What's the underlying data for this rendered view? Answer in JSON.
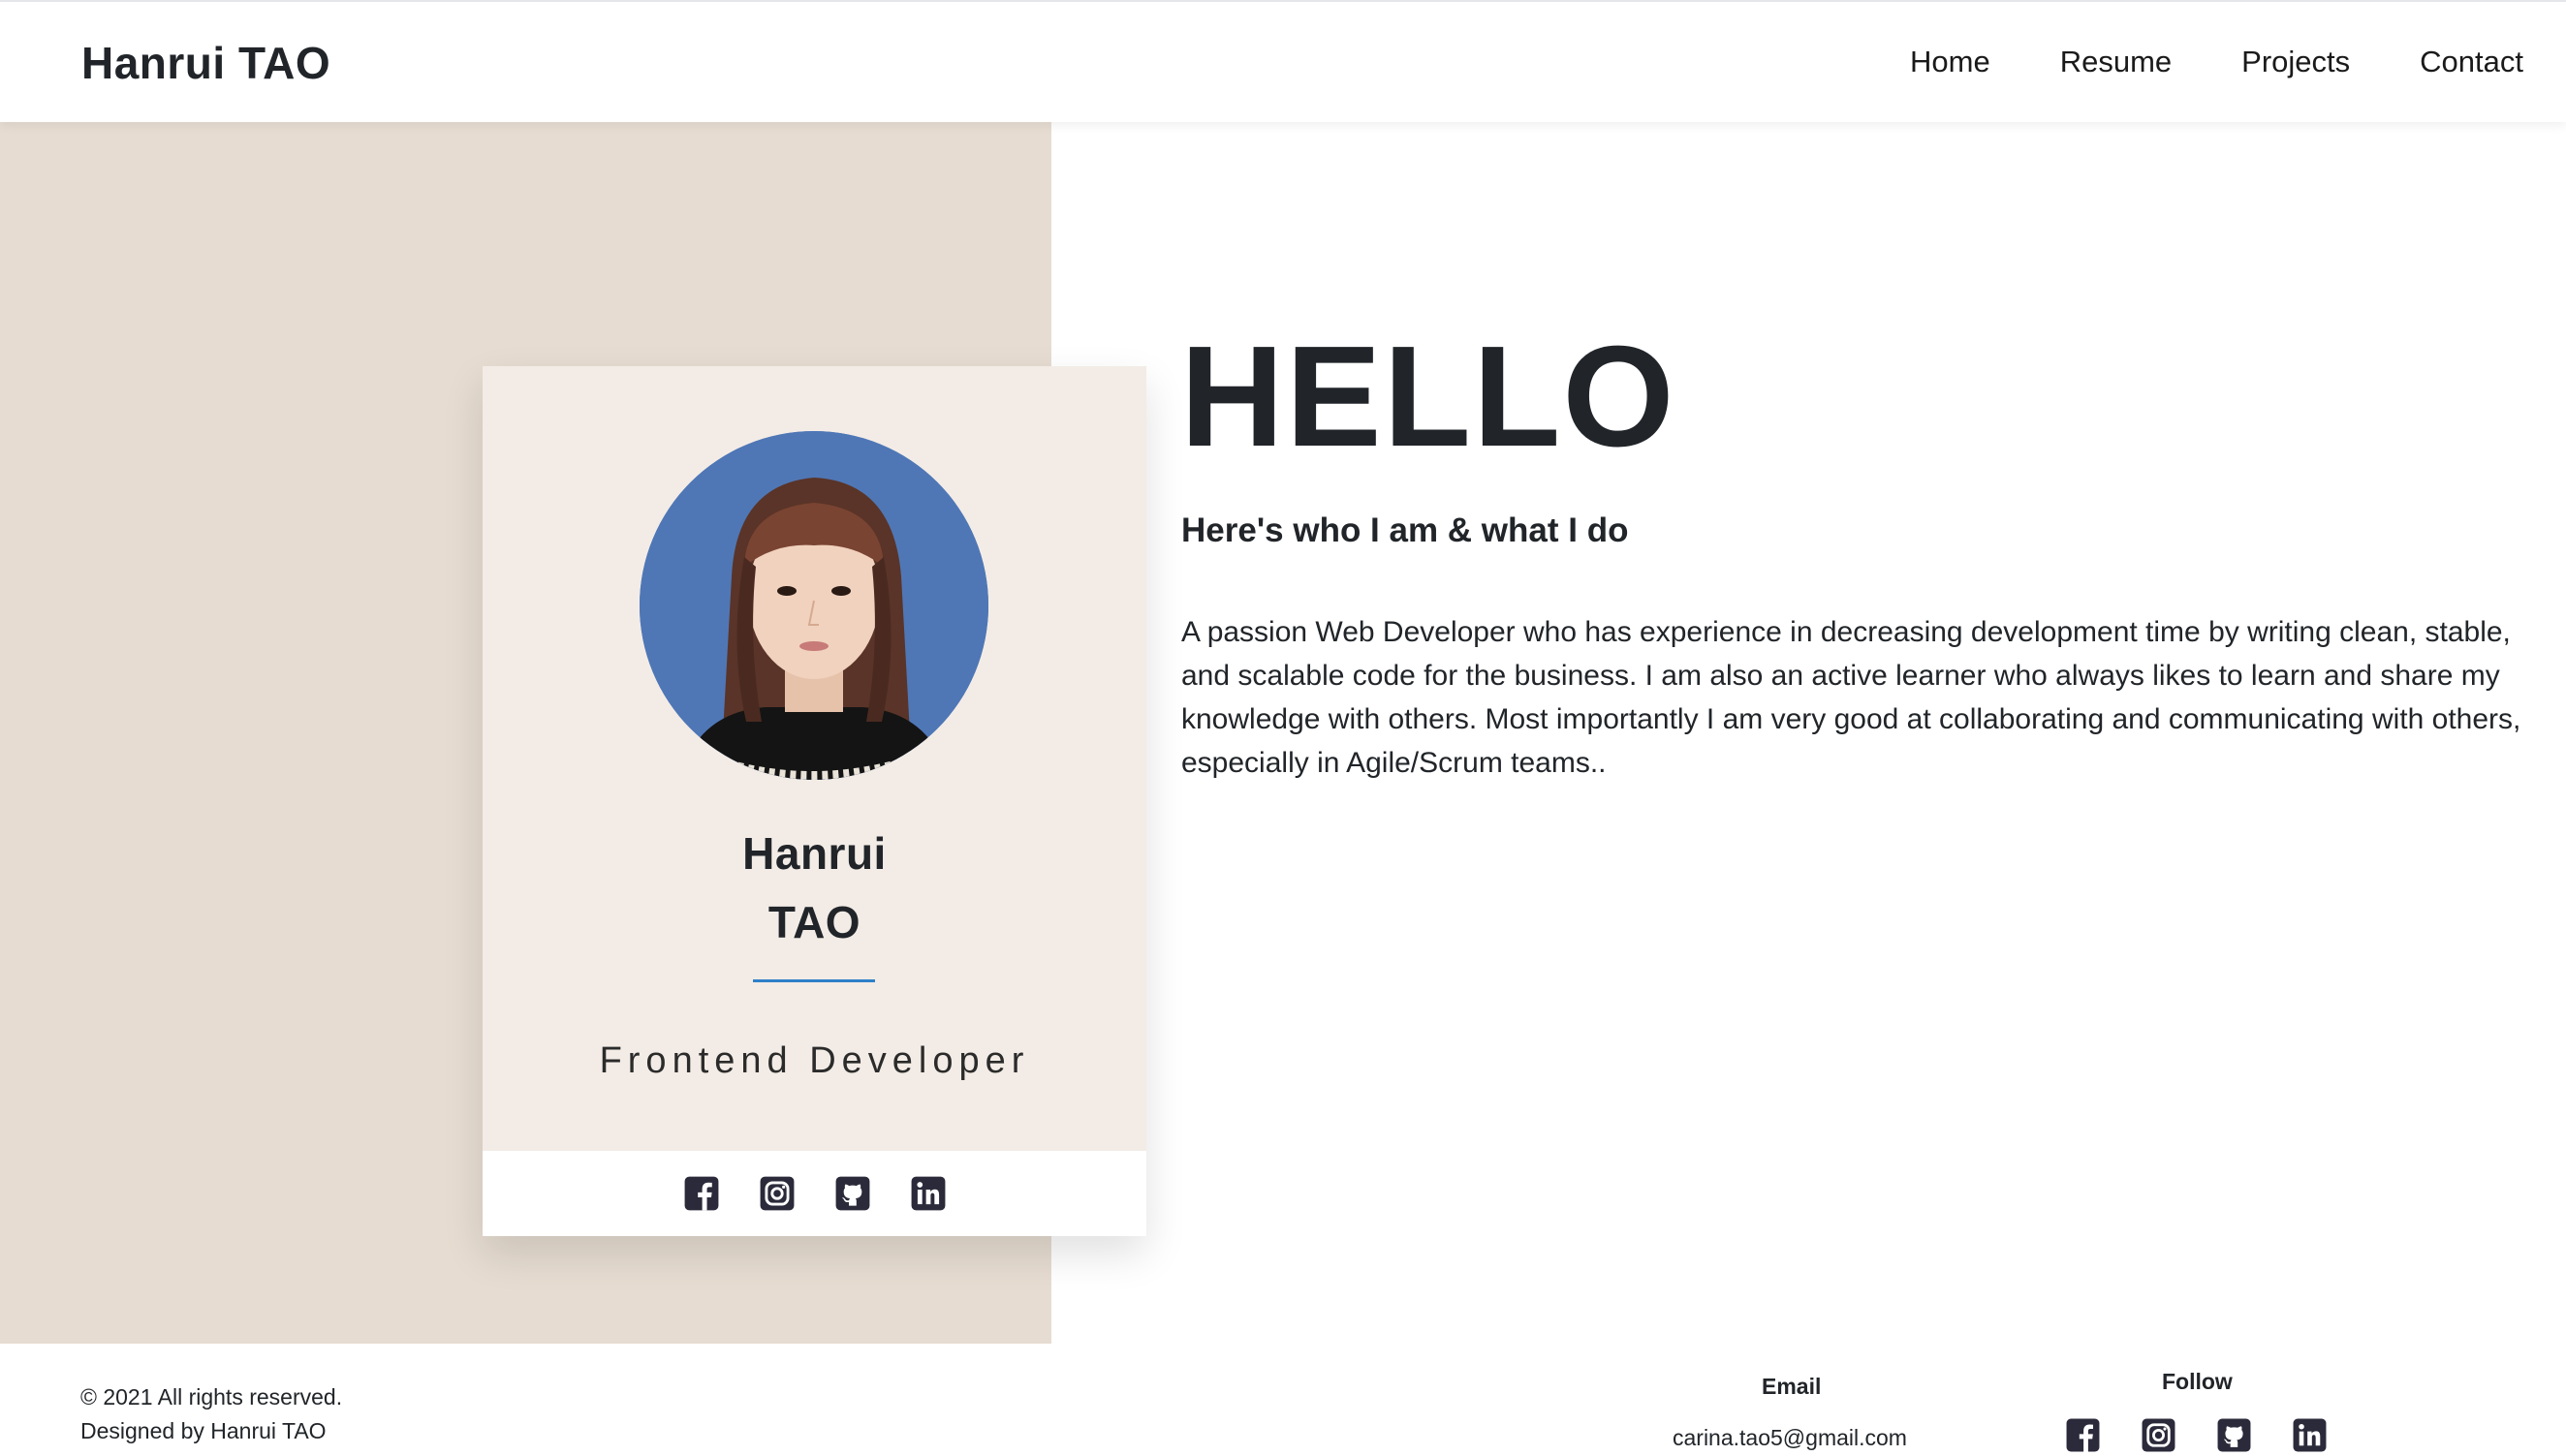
{
  "header": {
    "brand": "Hanrui TAO",
    "nav": [
      {
        "label": "Home"
      },
      {
        "label": "Resume"
      },
      {
        "label": "Projects"
      },
      {
        "label": "Contact"
      }
    ]
  },
  "profile_card": {
    "first_name": "Hanrui",
    "last_name": "TAO",
    "role": "Frontend Developer",
    "accent_color": "#2f80c9",
    "background_color": "#f3ece6",
    "social_icons": [
      "facebook-icon",
      "instagram-icon",
      "github-icon",
      "linkedin-icon"
    ]
  },
  "main": {
    "greeting": "HELLO",
    "subtitle": "Here's who I am & what I do",
    "about": "A passion Web Developer who has experience in decreasing development time by writing clean, stable, and scalable code for the business. I am also an active learner who always likes to learn and share my knowledge with others. Most importantly I am very good at collaborating and communicating with others, especially in Agile/Scrum teams.."
  },
  "footer": {
    "copyright": "© 2021 All rights reserved.",
    "designed_by": "Designed by Hanrui TAO",
    "email_title": "Email",
    "email": "carina.tao5@gmail.com",
    "follow_title": "Follow",
    "social_icons": [
      "facebook-icon",
      "instagram-icon",
      "github-icon",
      "linkedin-icon"
    ]
  },
  "colors": {
    "side_panel": "#e6dcd1",
    "text": "#212529",
    "icon": "#2a2a3a"
  }
}
